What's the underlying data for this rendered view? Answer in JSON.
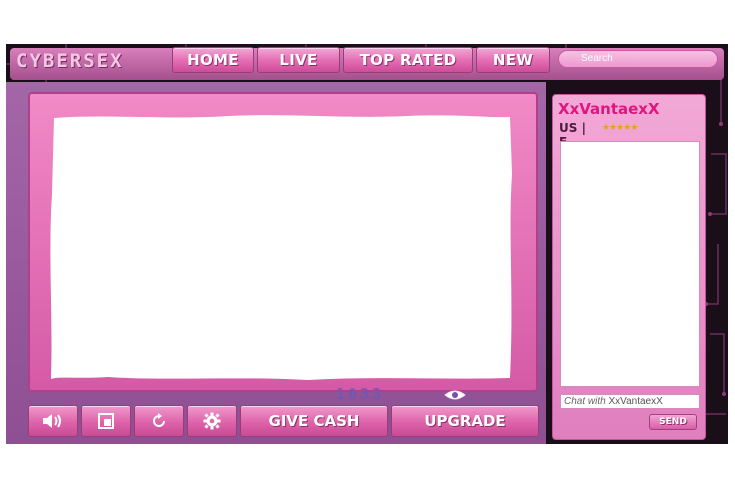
{
  "nav": {
    "logo": "CYBERSEX",
    "items": [
      "HOME",
      "LIVE",
      "TOP RATED",
      "NEW"
    ],
    "search_placeholder": "Search"
  },
  "player": {
    "view_count": "1033",
    "controls": {
      "volume_icon": "speaker-icon",
      "fullscreen_icon": "window-icon",
      "refresh_icon": "refresh-icon",
      "settings_icon": "gear-icon",
      "give_cash_label": "GIVE CASH",
      "upgrade_label": "UPGRADE"
    }
  },
  "chat": {
    "username": "XxVantaexX",
    "meta": "US | F",
    "rating": 5,
    "input_prefix": "Chat with",
    "input_name": "XxVantaexX",
    "send_label": "SEND"
  },
  "colors": {
    "accent_pink": "#e56fb4",
    "username_pink": "#e0157f",
    "stage_purple": "#a366a7",
    "star_gold": "#e4a21c"
  }
}
